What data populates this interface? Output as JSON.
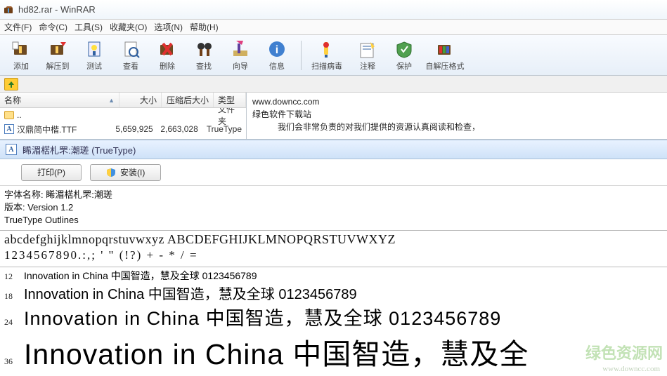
{
  "titlebar": {
    "title": "hd82.rar - WinRAR"
  },
  "menu": {
    "file": "文件(F)",
    "cmd": "命令(C)",
    "tools": "工具(S)",
    "fav": "收藏夹(O)",
    "opts": "选项(N)",
    "help": "帮助(H)"
  },
  "toolbar": {
    "add": "添加",
    "extract": "解压到",
    "test": "测试",
    "view": "查看",
    "delete": "删除",
    "find": "查找",
    "wizard": "向导",
    "info": "信息",
    "virus": "扫描病毒",
    "comment": "注释",
    "protect": "保护",
    "sfx": "自解压格式"
  },
  "columns": {
    "name": "名称",
    "size": "大小",
    "csize": "压缩后大小",
    "type": "类型"
  },
  "rows": [
    {
      "icon": "folder",
      "name": "..",
      "size": "",
      "csize": "",
      "type": "文件夹"
    },
    {
      "icon": "ttf",
      "name": "汉鼎简中楷.TTF",
      "size": "5,659,925",
      "csize": "2,663,028",
      "type": "TrueType"
    }
  ],
  "side": {
    "url": "www.downcc.com",
    "tag": "绿色软件下载站",
    "note": "我们会非常负责的对我们提供的资源认真阅读和检查，"
  },
  "fontwin": {
    "title": "睎湄楛札罘:潮瑳 (TrueType)",
    "print": "打印(P)",
    "install": "安装(I)",
    "fontname_label": "字体名称:",
    "fontname_value": "睎湄楛札罘:潮瑳",
    "version": "版本: Version 1.2",
    "outlines": "TrueType Outlines",
    "glyphs": "abcdefghijklmnopqrstuvwxyz ABCDEFGHIJKLMNOPQRSTUVWXYZ",
    "nums": "1234567890.:,; ' \" (!?) + - * / =",
    "sample": "Innovation in China 中国智造，慧及全球 0123456789",
    "sample_short": "Innovation in China 中国智造，慧及全",
    "sizes": [
      "12",
      "18",
      "24",
      "36"
    ]
  },
  "watermark": {
    "brand": "绿色资源网",
    "url": "www.downcc.com"
  }
}
